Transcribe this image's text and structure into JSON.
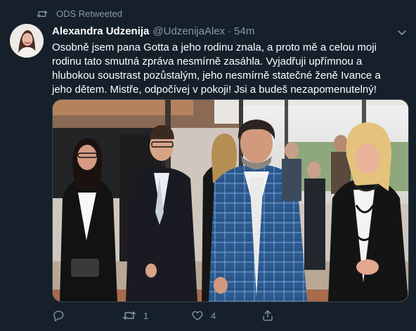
{
  "retweet": {
    "label": "ODS Retweeted"
  },
  "tweet": {
    "display_name": "Alexandra Udzenija",
    "handle": "@UdzenijaAlex",
    "separator": "·",
    "time": "54m",
    "text": "Osobně jsem pana Gotta a jeho rodinu znala, a proto mě a celou moji rodinu tato smutná zpráva nesmírně zasáhla. Vyjadřuji upřímnou a hlubokou soustrast pozůstalým, jeho nesmírně statečné ženě Ivance a jeho dětem. Mistře, odpočívej v pokoji! Jsi a budeš nezapomenutelný!"
  },
  "actions": {
    "reply_count": "",
    "retweet_count": "1",
    "like_count": "4"
  },
  "icons": [
    "retweet-icon",
    "avatar-photo",
    "chevron-down-icon",
    "reply-icon",
    "retweet-icon",
    "like-icon",
    "share-icon"
  ],
  "colors": {
    "background": "#15202b",
    "text": "#ffffff",
    "secondary": "#8899a6",
    "border": "#38444d"
  }
}
